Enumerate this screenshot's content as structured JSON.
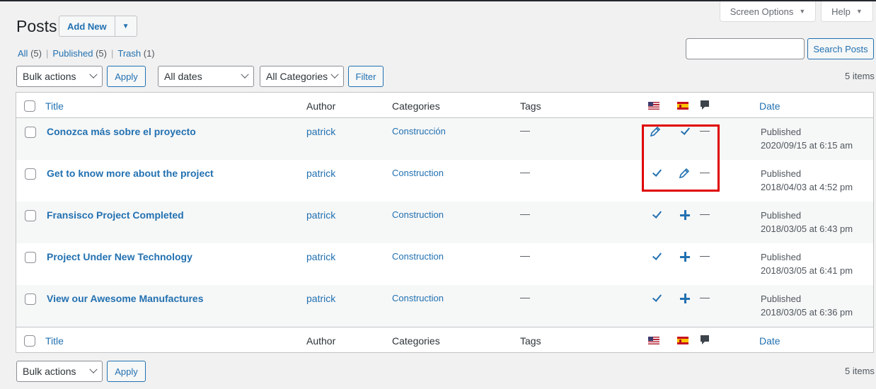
{
  "meta_tabs": {
    "screen_options": "Screen Options",
    "help": "Help"
  },
  "header": {
    "title": "Posts",
    "add_new": "Add New"
  },
  "filters_links": {
    "all": "All",
    "all_count": "(5)",
    "published": "Published",
    "published_count": "(5)",
    "trash": "Trash",
    "trash_count": "(1)",
    "separator": "|"
  },
  "search": {
    "placeholder": "",
    "button": "Search Posts"
  },
  "toolbar_top": {
    "bulk_actions": "Bulk actions",
    "apply": "Apply",
    "dates": "All dates",
    "categories": "All Categories",
    "filter": "Filter",
    "items": "5 items"
  },
  "toolbar_bottom": {
    "bulk_actions": "Bulk actions",
    "apply": "Apply",
    "items": "5 items"
  },
  "columns": {
    "title": "Title",
    "author": "Author",
    "categories": "Categories",
    "tags": "Tags",
    "date": "Date"
  },
  "rows": [
    {
      "title": "Conozca más sobre el proyecto",
      "author": "patrick",
      "category": "Construcción",
      "tags": "—",
      "lang_en": "edit",
      "lang_es": "check",
      "comments": "—",
      "status": "Published",
      "date": "2020/09/15 at 6:15 am"
    },
    {
      "title": "Get to know more about the project",
      "author": "patrick",
      "category": "Construction",
      "tags": "—",
      "lang_en": "check",
      "lang_es": "edit",
      "comments": "—",
      "status": "Published",
      "date": "2018/04/03 at 4:52 pm"
    },
    {
      "title": "Fransisco Project Completed",
      "author": "patrick",
      "category": "Construction",
      "tags": "—",
      "lang_en": "check",
      "lang_es": "add",
      "comments": "—",
      "status": "Published",
      "date": "2018/03/05 at 6:43 pm"
    },
    {
      "title": "Project Under New Technology",
      "author": "patrick",
      "category": "Construction",
      "tags": "—",
      "lang_en": "check",
      "lang_es": "add",
      "comments": "—",
      "status": "Published",
      "date": "2018/03/05 at 6:41 pm"
    },
    {
      "title": "View our Awesome Manufactures",
      "author": "patrick",
      "category": "Construction",
      "tags": "—",
      "lang_en": "check",
      "lang_es": "add",
      "comments": "—",
      "status": "Published",
      "date": "2018/03/05 at 6:36 pm"
    }
  ],
  "colors": {
    "link": "#2271b1",
    "highlight": "#e00000",
    "border": "#c3c4c7"
  },
  "icons": {
    "lang_en": "us-flag-icon",
    "lang_es": "spain-flag-icon",
    "comments": "comment-bubble-icon",
    "edit": "pencil-icon",
    "check": "checkmark-icon",
    "add": "plus-icon"
  }
}
